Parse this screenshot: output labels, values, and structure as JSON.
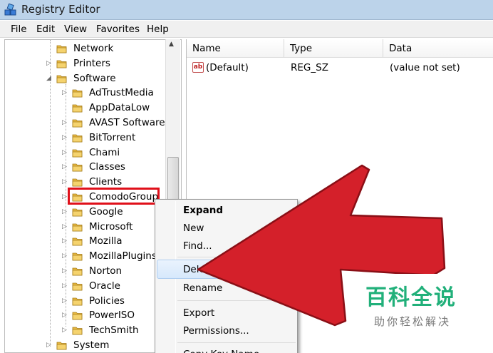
{
  "window": {
    "title": "Registry Editor"
  },
  "menu": [
    "File",
    "Edit",
    "View",
    "Favorites",
    "Help"
  ],
  "tree": {
    "items": [
      {
        "label": "Network",
        "level": 0,
        "expander": ""
      },
      {
        "label": "Printers",
        "level": 0,
        "expander": "▷"
      },
      {
        "label": "Software",
        "level": 0,
        "expander": "◢"
      },
      {
        "label": "AdTrustMedia",
        "level": 1,
        "expander": "▷"
      },
      {
        "label": "AppDataLow",
        "level": 1,
        "expander": ""
      },
      {
        "label": "AVAST Software",
        "level": 1,
        "expander": "▷"
      },
      {
        "label": "BitTorrent",
        "level": 1,
        "expander": "▷"
      },
      {
        "label": "Chami",
        "level": 1,
        "expander": "▷"
      },
      {
        "label": "Classes",
        "level": 1,
        "expander": "▷"
      },
      {
        "label": "Clients",
        "level": 1,
        "expander": "▷"
      },
      {
        "label": "ComodoGroup",
        "level": 1,
        "expander": "▷",
        "selected": true
      },
      {
        "label": "Google",
        "level": 1,
        "expander": "▷"
      },
      {
        "label": "Microsoft",
        "level": 1,
        "expander": "▷"
      },
      {
        "label": "Mozilla",
        "level": 1,
        "expander": "▷"
      },
      {
        "label": "MozillaPlugins",
        "level": 1,
        "expander": "▷"
      },
      {
        "label": "Norton",
        "level": 1,
        "expander": "▷"
      },
      {
        "label": "Oracle",
        "level": 1,
        "expander": "▷"
      },
      {
        "label": "Policies",
        "level": 1,
        "expander": "▷"
      },
      {
        "label": "PowerISO",
        "level": 1,
        "expander": "▷"
      },
      {
        "label": "TechSmith",
        "level": 1,
        "expander": "▷"
      },
      {
        "label": "System",
        "level": 0,
        "expander": "▷"
      }
    ]
  },
  "list": {
    "columns": [
      "Name",
      "Type",
      "Data"
    ],
    "rows": [
      {
        "name": "(Default)",
        "type": "REG_SZ",
        "data": "(value not set)",
        "icon": "string-value-icon"
      }
    ]
  },
  "context_menu": {
    "items": [
      {
        "label": "Expand",
        "bold": true
      },
      {
        "label": "New"
      },
      {
        "label": "Find..."
      },
      {
        "label": "Delete",
        "hovered": true
      },
      {
        "label": "Rename"
      },
      {
        "label": "Export"
      },
      {
        "label": "Permissions..."
      },
      {
        "label": "Copy Key Name"
      }
    ]
  },
  "overlay": {
    "arrow_color": "#d4202a",
    "highlight_color": "#e0101a"
  },
  "watermark": {
    "main": "百科全说",
    "sub": "助你轻松解决"
  }
}
